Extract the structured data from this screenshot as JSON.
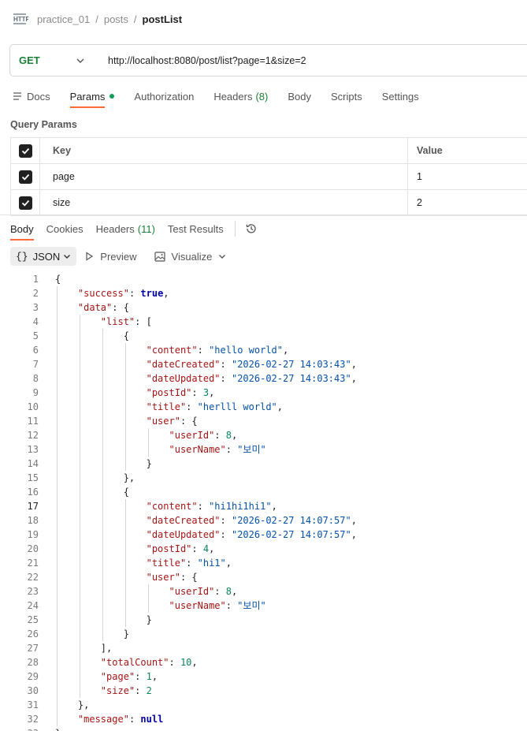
{
  "breadcrumb": [
    "practice_01",
    "posts",
    "postList"
  ],
  "request": {
    "method": "GET",
    "url": "http://localhost:8080/post/list?page=1&size=2"
  },
  "request_tabs": [
    {
      "label": "Docs"
    },
    {
      "label": "Params"
    },
    {
      "label": "Authorization"
    },
    {
      "label": "Headers",
      "count": "(8)"
    },
    {
      "label": "Body"
    },
    {
      "label": "Scripts"
    },
    {
      "label": "Settings"
    }
  ],
  "query_params": {
    "title": "Query Params",
    "columns": {
      "key": "Key",
      "value": "Value"
    },
    "rows": [
      {
        "key": "page",
        "value": "1",
        "checked": true
      },
      {
        "key": "size",
        "value": "2",
        "checked": true
      }
    ]
  },
  "response_tabs": [
    {
      "label": "Body"
    },
    {
      "label": "Cookies"
    },
    {
      "label": "Headers",
      "count": "(11)"
    },
    {
      "label": "Test Results"
    }
  ],
  "body_toolbar": {
    "format": "JSON",
    "preview": "Preview",
    "visualize": "Visualize"
  },
  "colors": {
    "accent": "#ff6c37",
    "method_get": "#1a7f37",
    "json_key": "#a31515",
    "json_string": "#0451a5",
    "json_number": "#098658"
  },
  "code_lines": [
    "{",
    "    \"success\": true,",
    "    \"data\": {",
    "        \"list\": [",
    "            {",
    "                \"content\": \"hello world\",",
    "                \"dateCreated\": \"2026-02-27 14:03:43\",",
    "                \"dateUpdated\": \"2026-02-27 14:03:43\",",
    "                \"postId\": 3,",
    "                \"title\": \"herlll world\",",
    "                \"user\": {",
    "                    \"userId\": 8,",
    "                    \"userName\": \"보미\"",
    "                }",
    "            },",
    "            {",
    "                \"content\": \"hi1hi1hi1\",",
    "                \"dateCreated\": \"2026-02-27 14:07:57\",",
    "                \"dateUpdated\": \"2026-02-27 14:07:57\",",
    "                \"postId\": 4,",
    "                \"title\": \"hi1\",",
    "                \"user\": {",
    "                    \"userId\": 8,",
    "                    \"userName\": \"보미\"",
    "                }",
    "            }",
    "        ],",
    "        \"totalCount\": 10,",
    "        \"page\": 1,",
    "        \"size\": 2",
    "    },",
    "    \"message\": null",
    "}"
  ]
}
